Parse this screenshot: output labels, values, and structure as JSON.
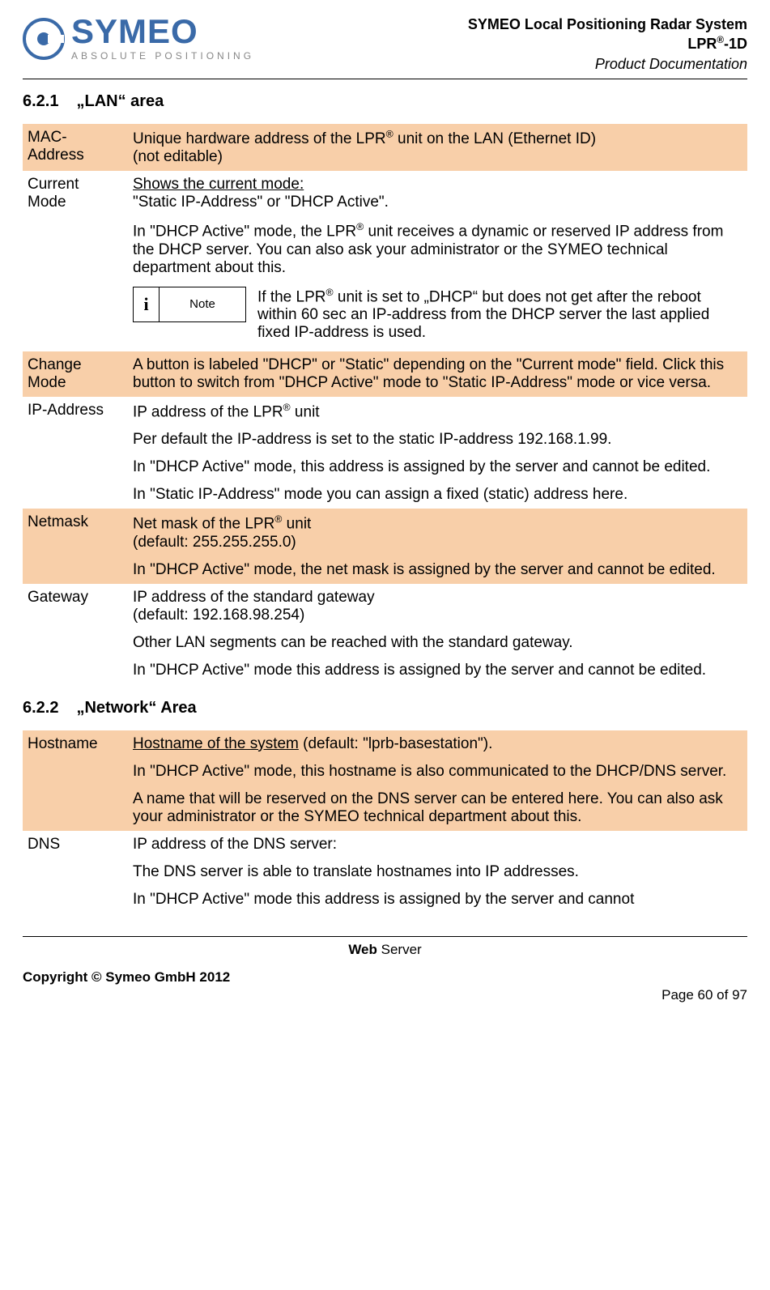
{
  "header": {
    "brand": "SYMEO",
    "tagline": "ABSOLUTE POSITIONING",
    "line1": "SYMEO Local Positioning Radar System",
    "line2_pre": "LPR",
    "line2_sup": "®",
    "line2_post": "-1D",
    "line3": "Product Documentation"
  },
  "section1": {
    "num": "6.2.1",
    "title": "„LAN“ area",
    "rows": [
      {
        "term": "MAC-Address",
        "shade": true,
        "content": "Unique hardware address of the LPR® unit on the LAN (Ethernet ID) (not editable)"
      },
      {
        "term": "Current Mode",
        "shade": false,
        "p1_underline": "Shows the current mode:",
        "p1_rest": " \"Static IP-Address\" or \"DHCP Active\".",
        "p2": "In \"DHCP Active\" mode, the LPR® unit receives a dynamic or reserved IP address from the DHCP server. You can also ask your administrator or the SYMEO technical department about this.",
        "note_label": "Note",
        "note_text": "If the LPR® unit is set to „DHCP“ but does not get after the reboot within 60 sec an IP-address from the DHCP server the last applied fixed IP-address is used."
      },
      {
        "term": "Change Mode",
        "shade": true,
        "content": "A button is labeled \"DHCP\" or \"Static\" depending on the \"Current mode\" field. Click this button to switch from \"DHCP Active\" mode to \"Static IP-Address\" mode or vice versa."
      },
      {
        "term": "IP-Address",
        "shade": false,
        "p1": "IP address of the LPR® unit",
        "p2": "Per default the IP-address is set to the static IP-address 192.168.1.99.",
        "p3": "In \"DHCP Active\" mode, this address is assigned by the server and cannot be edited.",
        "p4": "In \"Static IP-Address\" mode you can assign a fixed (static) address here."
      },
      {
        "term": "Netmask",
        "shade": true,
        "p1": "Net mask of the LPR® unit (default: 255.255.255.0)",
        "p2": "In \"DHCP Active\" mode, the net mask is assigned by the server and cannot be edited."
      },
      {
        "term": "Gateway",
        "shade": false,
        "p1": "IP address of the standard gateway (default: 192.168.98.254)",
        "p2": "Other LAN segments can be reached with the standard gateway.",
        "p3": "In \"DHCP Active\" mode this address is assigned by the server and cannot be edited."
      }
    ]
  },
  "section2": {
    "num": "6.2.2",
    "title": "„Network“ Area",
    "rows": [
      {
        "term": "Hostname",
        "shade": true,
        "p1_underline": "Hostname of the system",
        "p1_rest": " (default: \"lprb-basestation\").",
        "p2": "In \"DHCP Active\" mode, this hostname is also communicated to the DHCP/DNS server.",
        "p3": "A name that will be reserved on the DNS server can be entered here. You can also ask your administrator or the SYMEO technical department about this."
      },
      {
        "term": "DNS",
        "shade": false,
        "p1": "IP address of the DNS server:",
        "p2": "The DNS server is able to translate hostnames into IP addresses.",
        "p3": "In \"DHCP Active\" mode this address is assigned by the server and cannot"
      }
    ]
  },
  "footer": {
    "section_bold": "Web",
    "section_rest": " Server",
    "copyright": "Copyright © Symeo GmbH 2012",
    "page": "Page 60 of 97"
  }
}
